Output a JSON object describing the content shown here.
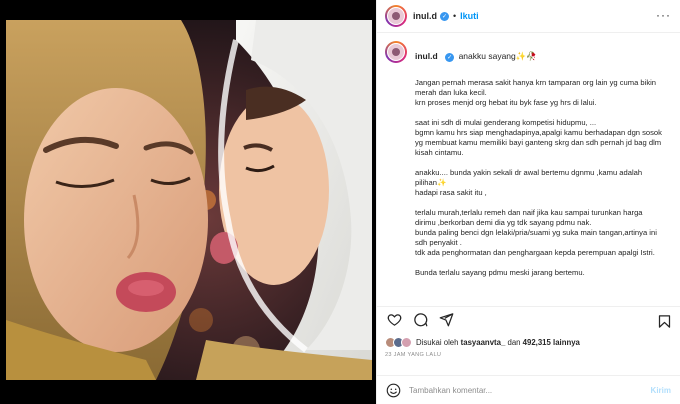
{
  "post": {
    "username": "inul.d",
    "follow_label": "Ikuti",
    "caption_first": "anakku sayang✨🥀",
    "caption_body": "Jangan pernah merasa sakit hanya krn tamparan org lain yg cuma bikin merah dan luka kecil.\nkrn proses menjd org hebat itu byk fase yg hrs di lalui.\n\nsaat ini sdh di mulai genderang kompetisi hidupmu, ...\nbgmn kamu hrs siap menghadapinya,apalgi kamu berhadapan dgn sosok yg membuat kamu memiliki bayi ganteng skrg dan sdh pernah jd bag dlm kisah cintamu.\n\nanakku.... bunda yakin sekali dr awal bertemu dgnmu ,kamu adalah pilihan✨\nhadapi rasa sakit itu ,\n\nterlalu murah,terlalu remeh dan naif jika kau sampai turunkan harga dirimu ,berkorban demi dia yg tdk sayang pdmu nak.\nbunda paling benci dgn lelaki/pria/suami yg suka main tangan,artinya ini sdh penyakit .\ntdk ada penghormatan dan penghargaan kepda perempuan apalgi Istri.\n\nBunda terlalu sayang pdmu meski jarang bertemu."
  },
  "likes": {
    "prefix": "Disukai oleh",
    "liker": "tasyaanvta_",
    "joiner": "dan",
    "count": "492,315",
    "suffix": "lainnya"
  },
  "timestamp": "23 JAM YANG LALU",
  "comment_bar": {
    "placeholder": "Tambahkan komentar...",
    "post_label": "Kirim"
  },
  "icons": {
    "like": "heart-icon",
    "comment": "comment-icon",
    "share": "share-icon",
    "save": "bookmark-icon",
    "emoji": "smiley-icon",
    "more": "more-icon",
    "verified": "verified-badge-icon"
  },
  "colors": {
    "accent": "#0095f6",
    "verified": "#3897f0",
    "post_disabled": "#b2dffc"
  }
}
